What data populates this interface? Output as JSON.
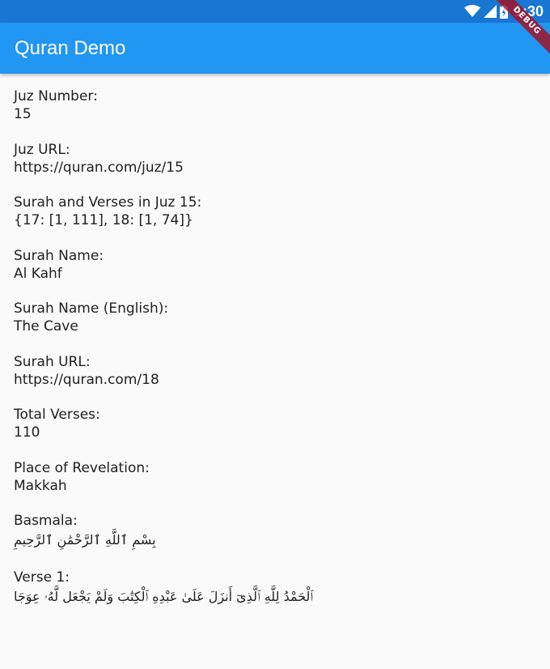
{
  "status_bar": {
    "time": "1:30",
    "icons": [
      "wifi-icon",
      "cell-signal-icon",
      "battery-charging-icon"
    ]
  },
  "app_bar": {
    "title": "Quran Demo"
  },
  "debug_banner": {
    "label": "DEBUG"
  },
  "fields": [
    {
      "label": "Juz Number:",
      "value": "15"
    },
    {
      "label": "Juz URL:",
      "value": "https://quran.com/juz/15"
    },
    {
      "label": "Surah and Verses in Juz 15:",
      "value": "{17: [1, 111], 18: [1, 74]}"
    },
    {
      "label": "Surah Name:",
      "value": "Al Kahf"
    },
    {
      "label": "Surah Name (English):",
      "value": "The Cave"
    },
    {
      "label": "Surah URL:",
      "value": "https://quran.com/18"
    },
    {
      "label": "Total Verses:",
      "value": "110"
    },
    {
      "label": "Place of Revelation:",
      "value": "Makkah"
    },
    {
      "label": "Basmala:",
      "value": "بِسْمِ ٱللَّهِ ٱلرَّحْمَٰنِ ٱلرَّحِيمِ"
    },
    {
      "label": "Verse 1:",
      "value": "ٱلْحَمْدُ لِلَّهِ ٱلَّذِىٓ أَنزَلَ عَلَىٰ عَبْدِهِ ٱلْكِتَٰبَ وَلَمْ يَجْعَل لَّهُۥ عِوَجَا"
    }
  ],
  "colors": {
    "status_bar": "#1976d2",
    "app_bar": "#2196f3",
    "background": "#fafafa",
    "text": "#212121",
    "debug_ribbon": "#a01428"
  }
}
